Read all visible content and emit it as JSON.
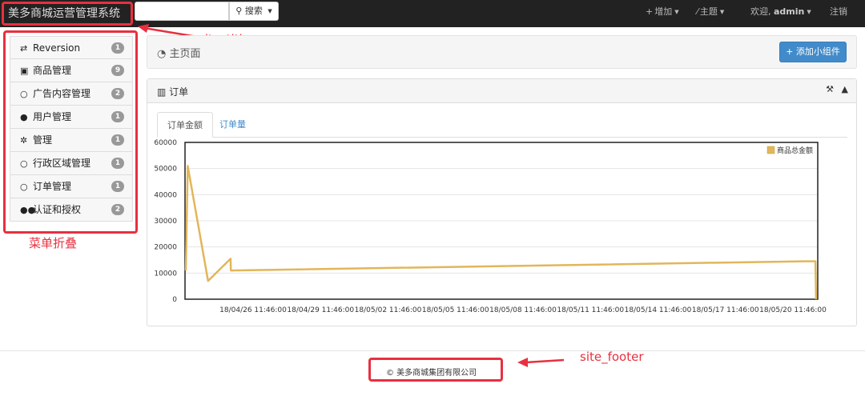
{
  "navbar": {
    "site_title": "美多商城运营管理系统",
    "search_button": "搜索",
    "add_label": "增加",
    "theme_label": "主题",
    "welcome_prefix": "欢迎,",
    "username": "admin",
    "logout_label": "注销"
  },
  "annotations": {
    "site_title": "site_title",
    "menu_collapse": "菜单折叠",
    "site_footer": "site_footer"
  },
  "sidebar": {
    "items": [
      {
        "icon": "exchange-icon",
        "label": "Reversion",
        "count": "1"
      },
      {
        "icon": "gift-icon",
        "label": "商品管理",
        "count": "9"
      },
      {
        "icon": "circle-icon",
        "label": "广告内容管理",
        "count": "2"
      },
      {
        "icon": "user-icon",
        "label": "用户管理",
        "count": "1"
      },
      {
        "icon": "cog-icon",
        "label": "管理",
        "count": "1"
      },
      {
        "icon": "circle-icon",
        "label": "行政区域管理",
        "count": "1"
      },
      {
        "icon": "circle-icon",
        "label": "订单管理",
        "count": "1"
      },
      {
        "icon": "group-icon",
        "label": "认证和授权",
        "count": "2"
      }
    ]
  },
  "header": {
    "title": "主页面",
    "add_widget": "添加小组件"
  },
  "panel": {
    "title": "订单",
    "tabs": [
      "订单金额",
      "订单量"
    ]
  },
  "chart_data": {
    "type": "line",
    "series": [
      {
        "name": "商品总金额",
        "color": "#e2b65a",
        "x": [
          "18/04/23 11:46",
          "18/04/23 14:00",
          "18/04/24 11:46",
          "18/04/25 11:46",
          "18/04/25 12:00",
          "18/05/21 00:00",
          "18/05/21 11:46",
          "18/05/21 12:30"
        ],
        "y": [
          11000,
          51000,
          7000,
          15500,
          11000,
          14500,
          14500,
          0
        ]
      }
    ],
    "x_ticks": [
      "18/04/26 11:46:00",
      "18/04/29 11:46:00",
      "18/05/02 11:46:00",
      "18/05/05 11:46:00",
      "18/05/08 11:46:00",
      "18/05/11 11:46:00",
      "18/05/14 11:46:00",
      "18/05/17 11:46:00",
      "18/05/20 11:46:00"
    ],
    "y_ticks": [
      "0",
      "10000",
      "20000",
      "30000",
      "40000",
      "50000",
      "60000"
    ],
    "ylim": [
      0,
      60000
    ],
    "grid": true,
    "legend_position": "top-right"
  },
  "footer": {
    "text": "© 美多商城集团有限公司"
  }
}
